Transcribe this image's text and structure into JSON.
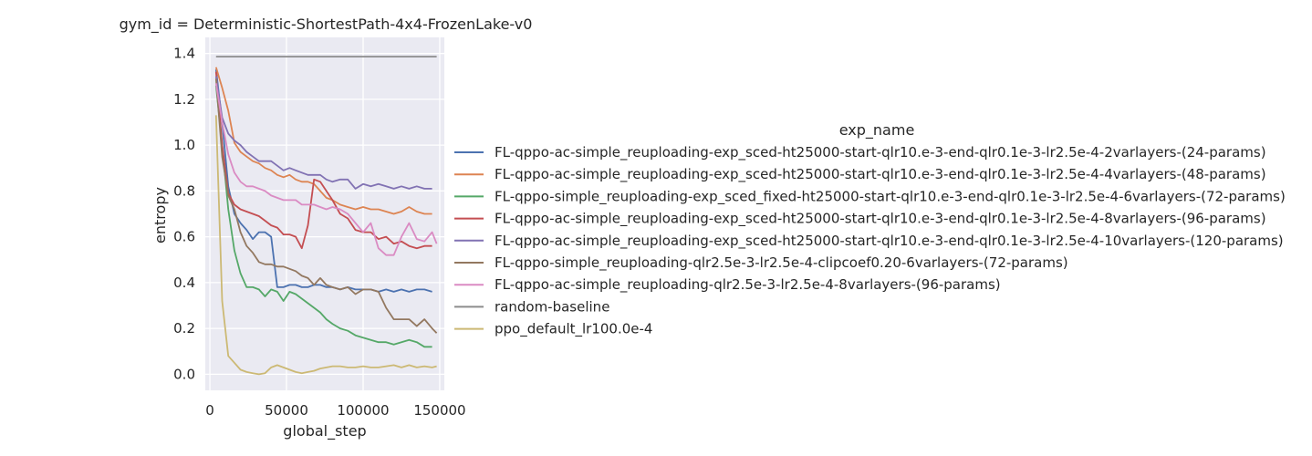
{
  "chart_data": {
    "type": "line",
    "title": "gym_id = Deterministic-ShortestPath-4x4-FrozenLake-v0",
    "xlabel": "global_step",
    "ylabel": "entropy",
    "xlim": [
      -3000,
      153000
    ],
    "ylim": [
      -0.07,
      1.47
    ],
    "xticks": [
      0,
      50000,
      100000,
      150000
    ],
    "xtick_labels": [
      "0",
      "50000",
      "100000",
      "150000"
    ],
    "yticks": [
      0.0,
      0.2,
      0.4,
      0.6,
      0.8,
      1.0,
      1.2,
      1.4
    ],
    "ytick_labels": [
      "0.0",
      "0.2",
      "0.4",
      "0.6",
      "0.8",
      "1.0",
      "1.2",
      "1.4"
    ],
    "grid": true,
    "legend_title": "exp_name",
    "legend_position": "right",
    "background_color": "#eaeaf2",
    "series": [
      {
        "name": "FL-qppo-ac-simple_reuploading-exp_sced-ht25000-start-qlr10.e-3-end-qlr0.1e-3-lr2.5e-4-2varlayers-(24-params)",
        "color": "#4c72b0",
        "points": [
          [
            4000,
            1.33
          ],
          [
            8000,
            1.1
          ],
          [
            12000,
            0.82
          ],
          [
            16000,
            0.7
          ],
          [
            20000,
            0.66
          ],
          [
            24000,
            0.63
          ],
          [
            28000,
            0.59
          ],
          [
            32000,
            0.62
          ],
          [
            36000,
            0.62
          ],
          [
            40000,
            0.6
          ],
          [
            44000,
            0.38
          ],
          [
            48000,
            0.38
          ],
          [
            52000,
            0.39
          ],
          [
            56000,
            0.39
          ],
          [
            60000,
            0.38
          ],
          [
            64000,
            0.38
          ],
          [
            68000,
            0.39
          ],
          [
            72000,
            0.39
          ],
          [
            76000,
            0.38
          ],
          [
            80000,
            0.38
          ],
          [
            85000,
            0.37
          ],
          [
            90000,
            0.38
          ],
          [
            95000,
            0.37
          ],
          [
            100000,
            0.37
          ],
          [
            105000,
            0.37
          ],
          [
            110000,
            0.36
          ],
          [
            115000,
            0.37
          ],
          [
            120000,
            0.36
          ],
          [
            125000,
            0.37
          ],
          [
            130000,
            0.36
          ],
          [
            135000,
            0.37
          ],
          [
            140000,
            0.37
          ],
          [
            145000,
            0.36
          ]
        ]
      },
      {
        "name": "FL-qppo-ac-simple_reuploading-exp_sced-ht25000-start-qlr10.e-3-end-qlr0.1e-3-lr2.5e-4-4varlayers-(48-params)",
        "color": "#dd8452",
        "points": [
          [
            4000,
            1.34
          ],
          [
            8000,
            1.25
          ],
          [
            12000,
            1.15
          ],
          [
            16000,
            1.01
          ],
          [
            20000,
            0.97
          ],
          [
            24000,
            0.95
          ],
          [
            28000,
            0.93
          ],
          [
            32000,
            0.92
          ],
          [
            36000,
            0.9
          ],
          [
            40000,
            0.89
          ],
          [
            44000,
            0.87
          ],
          [
            48000,
            0.86
          ],
          [
            52000,
            0.87
          ],
          [
            56000,
            0.85
          ],
          [
            60000,
            0.84
          ],
          [
            64000,
            0.84
          ],
          [
            68000,
            0.83
          ],
          [
            72000,
            0.8
          ],
          [
            76000,
            0.77
          ],
          [
            80000,
            0.76
          ],
          [
            85000,
            0.74
          ],
          [
            90000,
            0.73
          ],
          [
            95000,
            0.72
          ],
          [
            100000,
            0.73
          ],
          [
            105000,
            0.72
          ],
          [
            110000,
            0.72
          ],
          [
            115000,
            0.71
          ],
          [
            120000,
            0.7
          ],
          [
            125000,
            0.71
          ],
          [
            130000,
            0.73
          ],
          [
            135000,
            0.71
          ],
          [
            140000,
            0.7
          ],
          [
            145000,
            0.7
          ]
        ]
      },
      {
        "name": "FL-qppo-simple_reuploading-exp_sced_fixed-ht25000-start-qlr10.e-3-end-qlr0.1e-3-lr2.5e-4-6varlayers-(72-params)",
        "color": "#55a868",
        "points": [
          [
            4000,
            1.26
          ],
          [
            8000,
            1.0
          ],
          [
            12000,
            0.72
          ],
          [
            16000,
            0.54
          ],
          [
            20000,
            0.44
          ],
          [
            24000,
            0.38
          ],
          [
            28000,
            0.38
          ],
          [
            32000,
            0.37
          ],
          [
            36000,
            0.34
          ],
          [
            40000,
            0.37
          ],
          [
            44000,
            0.36
          ],
          [
            48000,
            0.32
          ],
          [
            52000,
            0.36
          ],
          [
            56000,
            0.35
          ],
          [
            60000,
            0.33
          ],
          [
            64000,
            0.31
          ],
          [
            68000,
            0.29
          ],
          [
            72000,
            0.27
          ],
          [
            76000,
            0.24
          ],
          [
            80000,
            0.22
          ],
          [
            85000,
            0.2
          ],
          [
            90000,
            0.19
          ],
          [
            95000,
            0.17
          ],
          [
            100000,
            0.16
          ],
          [
            105000,
            0.15
          ],
          [
            110000,
            0.14
          ],
          [
            115000,
            0.14
          ],
          [
            120000,
            0.13
          ],
          [
            125000,
            0.14
          ],
          [
            130000,
            0.15
          ],
          [
            135000,
            0.14
          ],
          [
            140000,
            0.12
          ],
          [
            145000,
            0.12
          ]
        ]
      },
      {
        "name": "FL-qppo-ac-simple_reuploading-exp_sced-ht25000-start-qlr10.e-3-end-qlr0.1e-3-lr2.5e-4-8varlayers-(96-params)",
        "color": "#c44e52",
        "points": [
          [
            4000,
            1.32
          ],
          [
            8000,
            1.0
          ],
          [
            12000,
            0.79
          ],
          [
            16000,
            0.74
          ],
          [
            20000,
            0.72
          ],
          [
            24000,
            0.71
          ],
          [
            28000,
            0.7
          ],
          [
            32000,
            0.69
          ],
          [
            36000,
            0.67
          ],
          [
            40000,
            0.65
          ],
          [
            44000,
            0.64
          ],
          [
            48000,
            0.61
          ],
          [
            52000,
            0.61
          ],
          [
            56000,
            0.6
          ],
          [
            60000,
            0.55
          ],
          [
            64000,
            0.65
          ],
          [
            68000,
            0.85
          ],
          [
            72000,
            0.84
          ],
          [
            76000,
            0.8
          ],
          [
            80000,
            0.76
          ],
          [
            85000,
            0.7
          ],
          [
            90000,
            0.68
          ],
          [
            95000,
            0.63
          ],
          [
            100000,
            0.62
          ],
          [
            105000,
            0.62
          ],
          [
            110000,
            0.59
          ],
          [
            115000,
            0.6
          ],
          [
            120000,
            0.57
          ],
          [
            125000,
            0.58
          ],
          [
            130000,
            0.56
          ],
          [
            135000,
            0.55
          ],
          [
            140000,
            0.56
          ],
          [
            145000,
            0.56
          ]
        ]
      },
      {
        "name": "FL-qppo-ac-simple_reuploading-exp_sced-ht25000-start-qlr10.e-3-end-qlr0.1e-3-lr2.5e-4-10varlayers-(120-params)",
        "color": "#8172b3",
        "points": [
          [
            4000,
            1.3
          ],
          [
            8000,
            1.12
          ],
          [
            12000,
            1.05
          ],
          [
            16000,
            1.02
          ],
          [
            20000,
            1.0
          ],
          [
            24000,
            0.97
          ],
          [
            28000,
            0.95
          ],
          [
            32000,
            0.93
          ],
          [
            36000,
            0.93
          ],
          [
            40000,
            0.93
          ],
          [
            44000,
            0.91
          ],
          [
            48000,
            0.89
          ],
          [
            52000,
            0.9
          ],
          [
            56000,
            0.89
          ],
          [
            60000,
            0.88
          ],
          [
            64000,
            0.87
          ],
          [
            68000,
            0.87
          ],
          [
            72000,
            0.87
          ],
          [
            76000,
            0.85
          ],
          [
            80000,
            0.84
          ],
          [
            85000,
            0.85
          ],
          [
            90000,
            0.85
          ],
          [
            95000,
            0.81
          ],
          [
            100000,
            0.83
          ],
          [
            105000,
            0.82
          ],
          [
            110000,
            0.83
          ],
          [
            115000,
            0.82
          ],
          [
            120000,
            0.81
          ],
          [
            125000,
            0.82
          ],
          [
            130000,
            0.81
          ],
          [
            135000,
            0.82
          ],
          [
            140000,
            0.81
          ],
          [
            145000,
            0.81
          ]
        ]
      },
      {
        "name": "FL-qppo-simple_reuploading-qlr2.5e-3-lr2.5e-4-clipcoef0.20-6varlayers-(72-params)",
        "color": "#937860",
        "points": [
          [
            4000,
            1.29
          ],
          [
            8000,
            0.95
          ],
          [
            12000,
            0.78
          ],
          [
            16000,
            0.72
          ],
          [
            20000,
            0.62
          ],
          [
            24000,
            0.56
          ],
          [
            28000,
            0.53
          ],
          [
            32000,
            0.49
          ],
          [
            36000,
            0.48
          ],
          [
            40000,
            0.48
          ],
          [
            44000,
            0.47
          ],
          [
            48000,
            0.47
          ],
          [
            52000,
            0.46
          ],
          [
            56000,
            0.45
          ],
          [
            60000,
            0.43
          ],
          [
            64000,
            0.42
          ],
          [
            68000,
            0.39
          ],
          [
            72000,
            0.42
          ],
          [
            76000,
            0.39
          ],
          [
            80000,
            0.38
          ],
          [
            85000,
            0.37
          ],
          [
            90000,
            0.38
          ],
          [
            95000,
            0.35
          ],
          [
            100000,
            0.37
          ],
          [
            105000,
            0.37
          ],
          [
            110000,
            0.36
          ],
          [
            115000,
            0.29
          ],
          [
            120000,
            0.24
          ],
          [
            125000,
            0.24
          ],
          [
            130000,
            0.24
          ],
          [
            135000,
            0.21
          ],
          [
            140000,
            0.24
          ],
          [
            145000,
            0.2
          ],
          [
            148000,
            0.18
          ]
        ]
      },
      {
        "name": "FL-qppo-ac-simple_reuploading-qlr2.5e-3-lr2.5e-4-8varlayers-(96-params)",
        "color": "#da8bc3",
        "points": [
          [
            4000,
            1.27
          ],
          [
            8000,
            1.1
          ],
          [
            12000,
            0.96
          ],
          [
            16000,
            0.88
          ],
          [
            20000,
            0.84
          ],
          [
            24000,
            0.82
          ],
          [
            28000,
            0.82
          ],
          [
            32000,
            0.81
          ],
          [
            36000,
            0.8
          ],
          [
            40000,
            0.78
          ],
          [
            44000,
            0.77
          ],
          [
            48000,
            0.76
          ],
          [
            52000,
            0.76
          ],
          [
            56000,
            0.76
          ],
          [
            60000,
            0.74
          ],
          [
            64000,
            0.74
          ],
          [
            68000,
            0.74
          ],
          [
            72000,
            0.73
          ],
          [
            76000,
            0.72
          ],
          [
            80000,
            0.73
          ],
          [
            85000,
            0.72
          ],
          [
            90000,
            0.7
          ],
          [
            95000,
            0.66
          ],
          [
            100000,
            0.62
          ],
          [
            105000,
            0.66
          ],
          [
            110000,
            0.55
          ],
          [
            115000,
            0.52
          ],
          [
            120000,
            0.52
          ],
          [
            125000,
            0.6
          ],
          [
            130000,
            0.66
          ],
          [
            135000,
            0.59
          ],
          [
            140000,
            0.58
          ],
          [
            145000,
            0.62
          ],
          [
            148000,
            0.57
          ]
        ]
      },
      {
        "name": "random-baseline",
        "color": "#8c8c8c",
        "points": [
          [
            4000,
            1.386
          ],
          [
            148000,
            1.386
          ]
        ]
      },
      {
        "name": "ppo_default_lr100.0e-4",
        "color": "#ccb974",
        "points": [
          [
            4000,
            1.13
          ],
          [
            8000,
            0.32
          ],
          [
            12000,
            0.08
          ],
          [
            16000,
            0.05
          ],
          [
            20000,
            0.02
          ],
          [
            24000,
            0.01
          ],
          [
            28000,
            0.005
          ],
          [
            32000,
            0.0
          ],
          [
            36000,
            0.005
          ],
          [
            40000,
            0.03
          ],
          [
            44000,
            0.04
          ],
          [
            48000,
            0.03
          ],
          [
            52000,
            0.02
          ],
          [
            56000,
            0.01
          ],
          [
            60000,
            0.005
          ],
          [
            64000,
            0.01
          ],
          [
            68000,
            0.015
          ],
          [
            72000,
            0.025
          ],
          [
            76000,
            0.03
          ],
          [
            80000,
            0.035
          ],
          [
            85000,
            0.035
          ],
          [
            90000,
            0.03
          ],
          [
            95000,
            0.03
          ],
          [
            100000,
            0.035
          ],
          [
            105000,
            0.03
          ],
          [
            110000,
            0.03
          ],
          [
            115000,
            0.035
          ],
          [
            120000,
            0.04
          ],
          [
            125000,
            0.03
          ],
          [
            130000,
            0.04
          ],
          [
            135000,
            0.03
          ],
          [
            140000,
            0.035
          ],
          [
            145000,
            0.03
          ],
          [
            148000,
            0.035
          ]
        ]
      }
    ]
  }
}
